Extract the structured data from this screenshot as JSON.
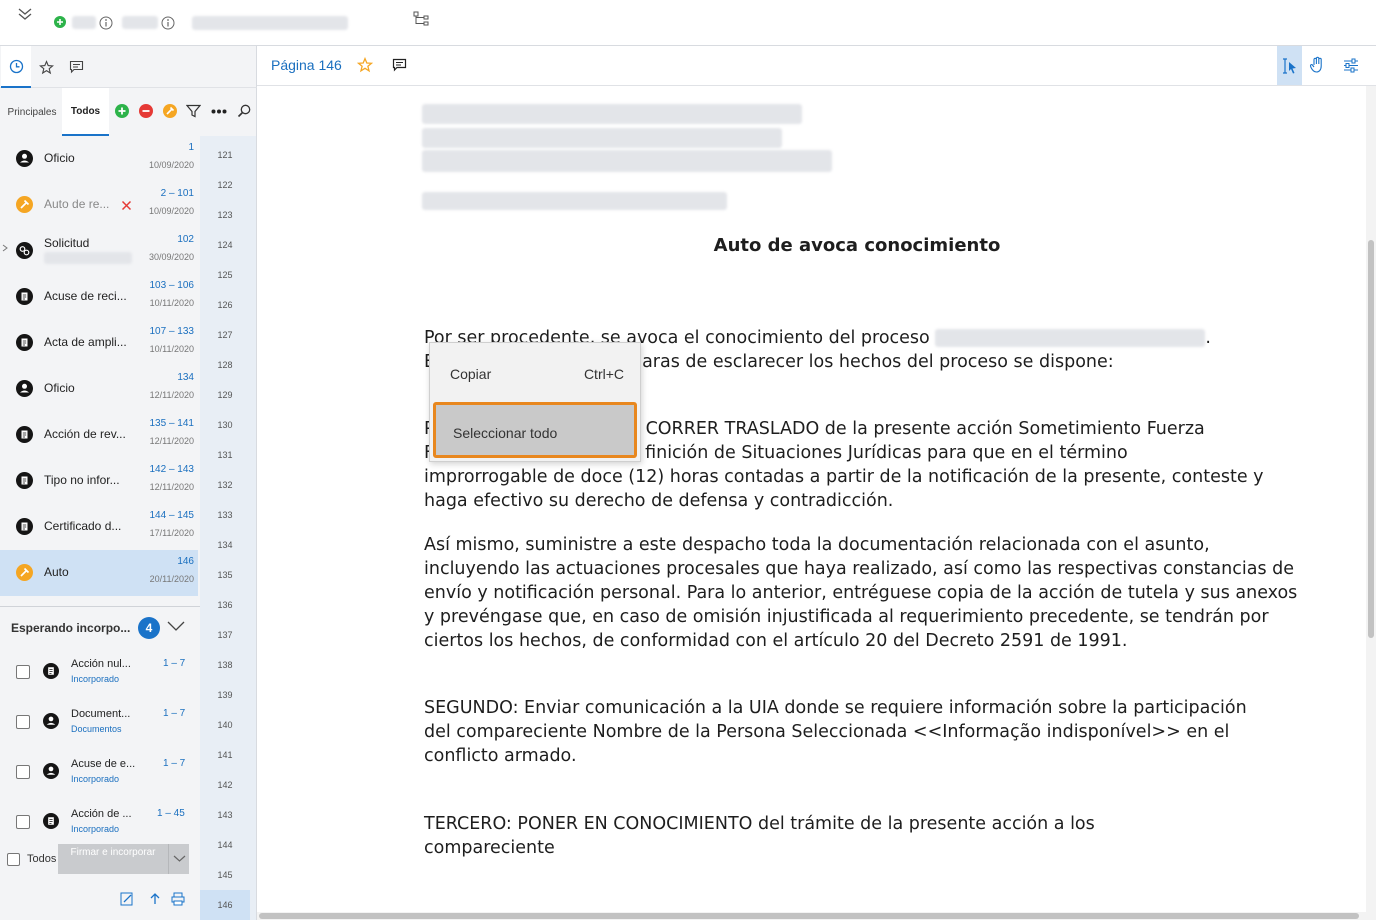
{
  "left_tabs": [
    "history-icon",
    "star-icon",
    "comment-icon"
  ],
  "filter": {
    "tab_main": "Principales",
    "tab_all": "Todos",
    "icons": [
      "add-icon",
      "remove-icon",
      "pin-icon",
      "filter-icon",
      "more-icon",
      "search-icon"
    ]
  },
  "documents": [
    {
      "name": "Oficio",
      "pages": "1",
      "date": "10/09/2020",
      "icon": "user-icon"
    },
    {
      "name": "Auto de re...",
      "pages": "2 – 101",
      "date": "10/09/2020",
      "icon": "gavel-icon",
      "status": "rejected"
    },
    {
      "name": "Solicitud",
      "pages": "102",
      "date": "30/09/2020",
      "icon": "request-icon"
    },
    {
      "name": "Acuse de reci...",
      "pages": "103 – 106",
      "date": "10/11/2020",
      "icon": "doc-icon"
    },
    {
      "name": "Acta de ampli...",
      "pages": "107 – 133",
      "date": "10/11/2020",
      "icon": "doc-icon"
    },
    {
      "name": "Oficio",
      "pages": "134",
      "date": "12/11/2020",
      "icon": "user-icon"
    },
    {
      "name": "Acción de rev...",
      "pages": "135 – 141",
      "date": "12/11/2020",
      "icon": "doc-icon"
    },
    {
      "name": "Tipo no infor...",
      "pages": "142 – 143",
      "date": "12/11/2020",
      "icon": "doc-icon"
    },
    {
      "name": "Certificado d...",
      "pages": "144 – 145",
      "date": "17/11/2020",
      "icon": "doc-icon"
    },
    {
      "name": "Auto",
      "pages": "146",
      "date": "20/11/2020",
      "icon": "gavel-icon",
      "selected": true
    }
  ],
  "page_numbers": [
    "121",
    "122",
    "123",
    "124",
    "125",
    "126",
    "127",
    "128",
    "129",
    "130",
    "131",
    "132",
    "133",
    "134",
    "135",
    "136",
    "137",
    "138",
    "139",
    "140",
    "141",
    "142",
    "143",
    "144",
    "145",
    "146"
  ],
  "pending": {
    "title": "Esperando incorpo...",
    "count": "4",
    "items": [
      {
        "name": "Acción nul...",
        "sub": "Incorporado",
        "pages": "1 – 7"
      },
      {
        "name": "Document...",
        "sub": "Documentos",
        "pages": "1 – 7"
      },
      {
        "name": "Acuse de e...",
        "sub": "Incorporado",
        "pages": "1 – 7"
      },
      {
        "name": "Acción de ...",
        "sub": "Incorporado",
        "pages": "1 – 45"
      }
    ],
    "select_all": "Todos",
    "sign_button": "Firmar e incorporar"
  },
  "content_header": {
    "page_label": "Página 146"
  },
  "document": {
    "title": "Auto de avoca conocimiento",
    "paragraph1_line1": "Por ser procedente, se avoca el conocimiento del proceso",
    "paragraph1_line2_end": "aras de esclarecer los hechos del proceso se dispone:",
    "p1_prefix": "E",
    "primero_prefix": "P",
    "primero_prefix2": "F",
    "primero_line1_end": "CORRER TRASLADO de la presente acción Sometimiento Fuerza",
    "primero_line2_end": "finición de Situaciones Jurídicas para que en el término",
    "primero_rest": "improrrogable de doce (12) horas contadas a partir de la notificación de la presente, conteste y haga efectivo su derecho de defensa y contradicción.",
    "asimismo": "Así mismo, suministre a este despacho toda la documentación relacionada con el asunto, incluyendo las actuaciones procesales que haya realizado, así como las respectivas constancias de envío y notificación personal. Para lo anterior, entréguese copia de la acción de tutela y sus anexos y prevéngase que, en caso de omisión injustificada al requerimiento precedente, se tendrán por ciertos los hechos, de conformidad con el artículo 20 del Decreto 2591 de 1991.",
    "segundo": "SEGUNDO: Enviar comunicación a la UIA donde se requiere información sobre la participación del compareciente Nombre de la Persona Seleccionada <<Informação indisponível>> en el conflicto armado.",
    "tercero": "TERCERO: PONER EN CONOCIMIENTO del trámite de la presente acción a los compareciente",
    "period": "."
  },
  "context_menu": {
    "copy_label": "Copiar",
    "copy_shortcut": "Ctrl+C",
    "select_all_label": "Seleccionar todo"
  },
  "colors": {
    "accent": "#1a73c9",
    "highlight_border": "#e8871e",
    "add_green": "#2db34a",
    "remove_red": "#e53935",
    "pin_orange": "#f5a623"
  }
}
